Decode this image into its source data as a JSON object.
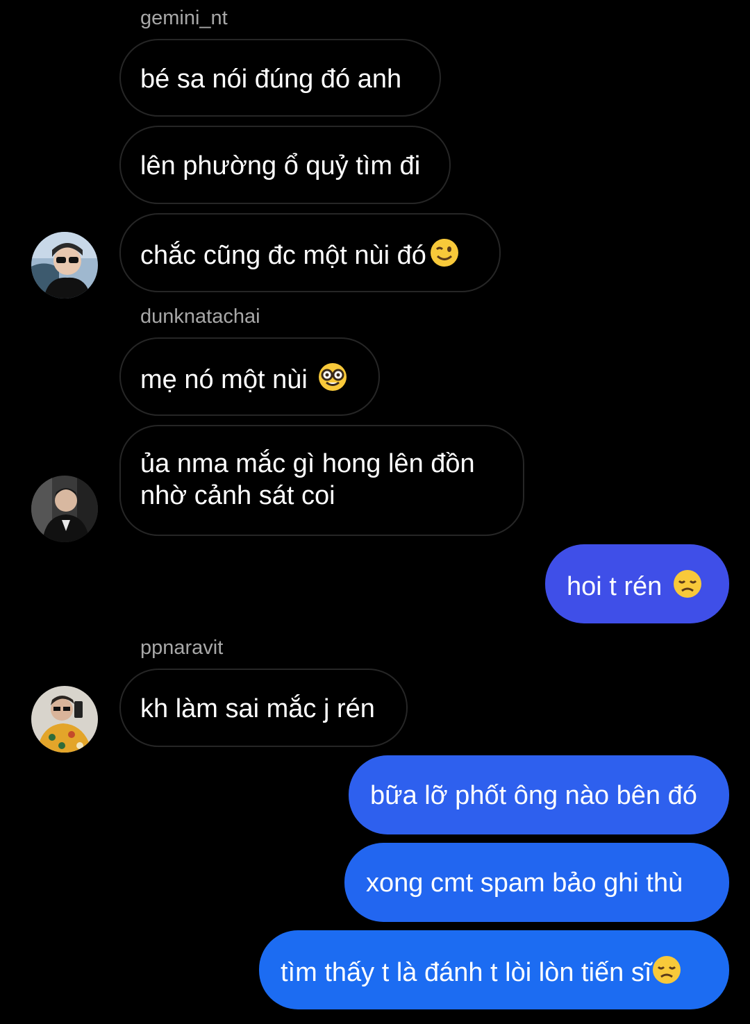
{
  "colors": {
    "background": "#000000",
    "incoming_border": "#262626",
    "sender_name": "#a8a8a8",
    "outgoing_gradient_top": "#4a4fe6",
    "outgoing_gradient_bottom": "#1e6ff2"
  },
  "conversation": {
    "messages": [
      {
        "sender": "gemini_nt",
        "text": "bé sa nói đúng đó anh",
        "direction": "incoming"
      },
      {
        "sender": "gemini_nt",
        "text": "lên phường ổ quỷ tìm đi",
        "direction": "incoming"
      },
      {
        "sender": "gemini_nt",
        "text": "chắc cũng đc một nùi đó",
        "emoji": "winking-face",
        "direction": "incoming"
      },
      {
        "sender": "dunknatachai",
        "text": "mẹ nó một nùi ",
        "emoji": "nerd-face",
        "direction": "incoming"
      },
      {
        "sender": "dunknatachai",
        "text": "ủa nma mắc gì hong lên đồn nhờ cảnh sát coi",
        "direction": "incoming"
      },
      {
        "sender": "me",
        "text": "hoi t rén ",
        "emoji": "disappointed-face",
        "direction": "outgoing"
      },
      {
        "sender": "ppnaravit",
        "text": "kh làm sai mắc j rén",
        "direction": "incoming"
      },
      {
        "sender": "me",
        "text": "bữa lỡ phốt ông nào bên đó",
        "direction": "outgoing"
      },
      {
        "sender": "me",
        "text": "xong cmt spam bảo ghi thù",
        "direction": "outgoing"
      },
      {
        "sender": "me",
        "text": "tìm thấy t là đánh t lòi lòn tiến sĩ",
        "emoji": "disappointed-face",
        "direction": "outgoing"
      }
    ]
  }
}
